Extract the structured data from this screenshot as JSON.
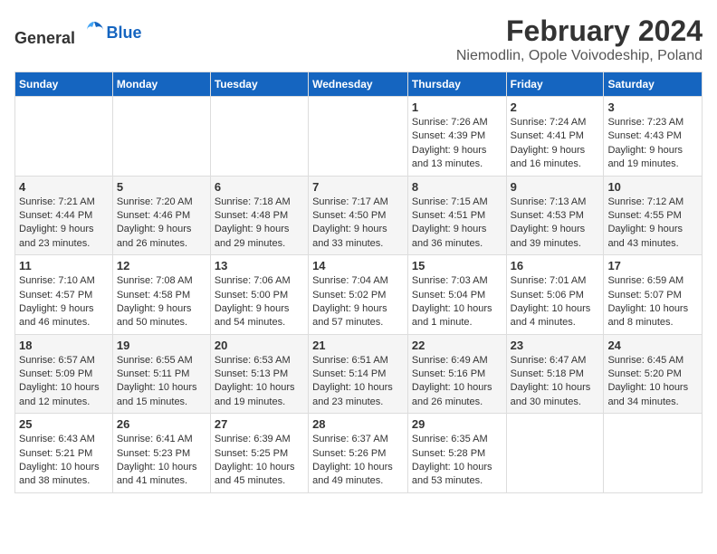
{
  "logo": {
    "text_general": "General",
    "text_blue": "Blue"
  },
  "title": {
    "month": "February 2024",
    "location": "Niemodlin, Opole Voivodeship, Poland"
  },
  "weekdays": [
    "Sunday",
    "Monday",
    "Tuesday",
    "Wednesday",
    "Thursday",
    "Friday",
    "Saturday"
  ],
  "weeks": [
    [
      {
        "day": "",
        "info": ""
      },
      {
        "day": "",
        "info": ""
      },
      {
        "day": "",
        "info": ""
      },
      {
        "day": "",
        "info": ""
      },
      {
        "day": "1",
        "info": "Sunrise: 7:26 AM\nSunset: 4:39 PM\nDaylight: 9 hours\nand 13 minutes."
      },
      {
        "day": "2",
        "info": "Sunrise: 7:24 AM\nSunset: 4:41 PM\nDaylight: 9 hours\nand 16 minutes."
      },
      {
        "day": "3",
        "info": "Sunrise: 7:23 AM\nSunset: 4:43 PM\nDaylight: 9 hours\nand 19 minutes."
      }
    ],
    [
      {
        "day": "4",
        "info": "Sunrise: 7:21 AM\nSunset: 4:44 PM\nDaylight: 9 hours\nand 23 minutes."
      },
      {
        "day": "5",
        "info": "Sunrise: 7:20 AM\nSunset: 4:46 PM\nDaylight: 9 hours\nand 26 minutes."
      },
      {
        "day": "6",
        "info": "Sunrise: 7:18 AM\nSunset: 4:48 PM\nDaylight: 9 hours\nand 29 minutes."
      },
      {
        "day": "7",
        "info": "Sunrise: 7:17 AM\nSunset: 4:50 PM\nDaylight: 9 hours\nand 33 minutes."
      },
      {
        "day": "8",
        "info": "Sunrise: 7:15 AM\nSunset: 4:51 PM\nDaylight: 9 hours\nand 36 minutes."
      },
      {
        "day": "9",
        "info": "Sunrise: 7:13 AM\nSunset: 4:53 PM\nDaylight: 9 hours\nand 39 minutes."
      },
      {
        "day": "10",
        "info": "Sunrise: 7:12 AM\nSunset: 4:55 PM\nDaylight: 9 hours\nand 43 minutes."
      }
    ],
    [
      {
        "day": "11",
        "info": "Sunrise: 7:10 AM\nSunset: 4:57 PM\nDaylight: 9 hours\nand 46 minutes."
      },
      {
        "day": "12",
        "info": "Sunrise: 7:08 AM\nSunset: 4:58 PM\nDaylight: 9 hours\nand 50 minutes."
      },
      {
        "day": "13",
        "info": "Sunrise: 7:06 AM\nSunset: 5:00 PM\nDaylight: 9 hours\nand 54 minutes."
      },
      {
        "day": "14",
        "info": "Sunrise: 7:04 AM\nSunset: 5:02 PM\nDaylight: 9 hours\nand 57 minutes."
      },
      {
        "day": "15",
        "info": "Sunrise: 7:03 AM\nSunset: 5:04 PM\nDaylight: 10 hours\nand 1 minute."
      },
      {
        "day": "16",
        "info": "Sunrise: 7:01 AM\nSunset: 5:06 PM\nDaylight: 10 hours\nand 4 minutes."
      },
      {
        "day": "17",
        "info": "Sunrise: 6:59 AM\nSunset: 5:07 PM\nDaylight: 10 hours\nand 8 minutes."
      }
    ],
    [
      {
        "day": "18",
        "info": "Sunrise: 6:57 AM\nSunset: 5:09 PM\nDaylight: 10 hours\nand 12 minutes."
      },
      {
        "day": "19",
        "info": "Sunrise: 6:55 AM\nSunset: 5:11 PM\nDaylight: 10 hours\nand 15 minutes."
      },
      {
        "day": "20",
        "info": "Sunrise: 6:53 AM\nSunset: 5:13 PM\nDaylight: 10 hours\nand 19 minutes."
      },
      {
        "day": "21",
        "info": "Sunrise: 6:51 AM\nSunset: 5:14 PM\nDaylight: 10 hours\nand 23 minutes."
      },
      {
        "day": "22",
        "info": "Sunrise: 6:49 AM\nSunset: 5:16 PM\nDaylight: 10 hours\nand 26 minutes."
      },
      {
        "day": "23",
        "info": "Sunrise: 6:47 AM\nSunset: 5:18 PM\nDaylight: 10 hours\nand 30 minutes."
      },
      {
        "day": "24",
        "info": "Sunrise: 6:45 AM\nSunset: 5:20 PM\nDaylight: 10 hours\nand 34 minutes."
      }
    ],
    [
      {
        "day": "25",
        "info": "Sunrise: 6:43 AM\nSunset: 5:21 PM\nDaylight: 10 hours\nand 38 minutes."
      },
      {
        "day": "26",
        "info": "Sunrise: 6:41 AM\nSunset: 5:23 PM\nDaylight: 10 hours\nand 41 minutes."
      },
      {
        "day": "27",
        "info": "Sunrise: 6:39 AM\nSunset: 5:25 PM\nDaylight: 10 hours\nand 45 minutes."
      },
      {
        "day": "28",
        "info": "Sunrise: 6:37 AM\nSunset: 5:26 PM\nDaylight: 10 hours\nand 49 minutes."
      },
      {
        "day": "29",
        "info": "Sunrise: 6:35 AM\nSunset: 5:28 PM\nDaylight: 10 hours\nand 53 minutes."
      },
      {
        "day": "",
        "info": ""
      },
      {
        "day": "",
        "info": ""
      }
    ]
  ]
}
